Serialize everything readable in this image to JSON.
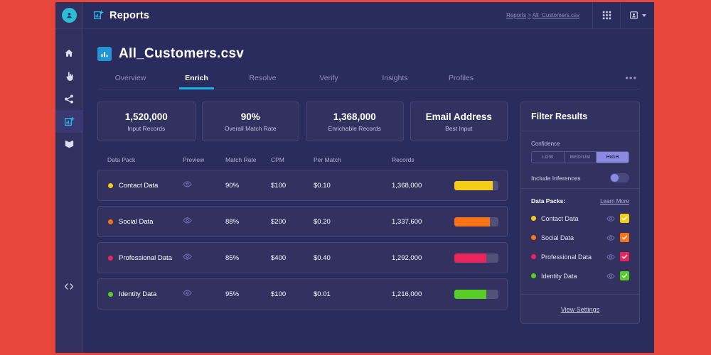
{
  "theme": {
    "page_border": "#e8463a",
    "app_bg": "#2b2c5e",
    "rail_bg": "#32305e",
    "card_bg": "#32315f",
    "border": "#464475",
    "accent_cyan": "#17b5e8",
    "accent_blue": "#2196d6",
    "accent_periwinkle": "#8b8ae0"
  },
  "rail": {
    "avatar_icon": "user-circle-icon",
    "items": [
      {
        "name": "home",
        "icon": "home-icon",
        "active": false
      },
      {
        "name": "audience",
        "icon": "hand-pointer-icon",
        "active": false
      },
      {
        "name": "connections",
        "icon": "network-share-icon",
        "active": false
      },
      {
        "name": "reports",
        "icon": "chart-add-icon",
        "active": true
      },
      {
        "name": "library",
        "icon": "book-open-icon",
        "active": false
      }
    ],
    "bottom_item": {
      "name": "developer",
      "icon": "code-brackets-icon"
    }
  },
  "topbar": {
    "icon": "chart-add-icon",
    "title": "Reports",
    "breadcrumb": {
      "parent": "Reports",
      "separator": ">",
      "current": "All_Customers.csv"
    },
    "apps_icon": "grid-apps-icon",
    "user_icon": "user-card-icon",
    "user_caret": "chevron-down-icon"
  },
  "page": {
    "file_icon": "bar-chart-icon",
    "title": "All_Customers.csv",
    "tabs": [
      {
        "label": "Overview",
        "active": false
      },
      {
        "label": "Enrich",
        "active": true
      },
      {
        "label": "Resolve",
        "active": false
      },
      {
        "label": "Verify",
        "active": false
      },
      {
        "label": "Insights",
        "active": false
      },
      {
        "label": "Profiles",
        "active": false
      }
    ],
    "more_label": "•••"
  },
  "stats": [
    {
      "value": "1,520,000",
      "label": "Input Records"
    },
    {
      "value": "90%",
      "label": "Overall Match Rate"
    },
    {
      "value": "1,368,000",
      "label": "Enrichable Records"
    },
    {
      "value": "Email Address",
      "label": "Best Input"
    }
  ],
  "table": {
    "columns": [
      "Data Pack",
      "Preview",
      "Match Rate",
      "CPM",
      "Per Match",
      "Records",
      ""
    ],
    "preview_icon": "eye-icon",
    "rows": [
      {
        "name": "Contact Data",
        "color": "#f4cc16",
        "match_rate": "90%",
        "cpm": "$100",
        "per_match": "$0.10",
        "records": "1,368,000",
        "bar_pct": 87
      },
      {
        "name": "Social Data",
        "color": "#f97316",
        "match_rate": "88%",
        "cpm": "$200",
        "per_match": "$0.20",
        "records": "1,337,600",
        "bar_pct": 80
      },
      {
        "name": "Professional Data",
        "color": "#e8265c",
        "match_rate": "85%",
        "cpm": "$400",
        "per_match": "$0.40",
        "records": "1,292,000",
        "bar_pct": 72
      },
      {
        "name": "Identity Data",
        "color": "#58cc27",
        "match_rate": "95%",
        "cpm": "$100",
        "per_match": "$0.01",
        "records": "1,216,000",
        "bar_pct": 72
      }
    ]
  },
  "filter": {
    "title": "Filter Results",
    "confidence_label": "Confidence",
    "confidence_options": [
      {
        "label": "LOW",
        "active": false
      },
      {
        "label": "MEDIUM",
        "active": false
      },
      {
        "label": "HIGH",
        "active": true
      }
    ],
    "inferences_label": "Include Inferences",
    "inferences_on": false,
    "packs_label": "Data Packs:",
    "learn_more_label": "Learn More",
    "preview_icon": "eye-icon",
    "packs": [
      {
        "name": "Contact Data",
        "color": "#f4cc16",
        "checked": true
      },
      {
        "name": "Social Data",
        "color": "#f97316",
        "checked": true
      },
      {
        "name": "Professional Data",
        "color": "#e8265c",
        "checked": true
      },
      {
        "name": "Identity Data",
        "color": "#58cc27",
        "checked": true
      }
    ],
    "view_settings_label": "View Settings"
  }
}
